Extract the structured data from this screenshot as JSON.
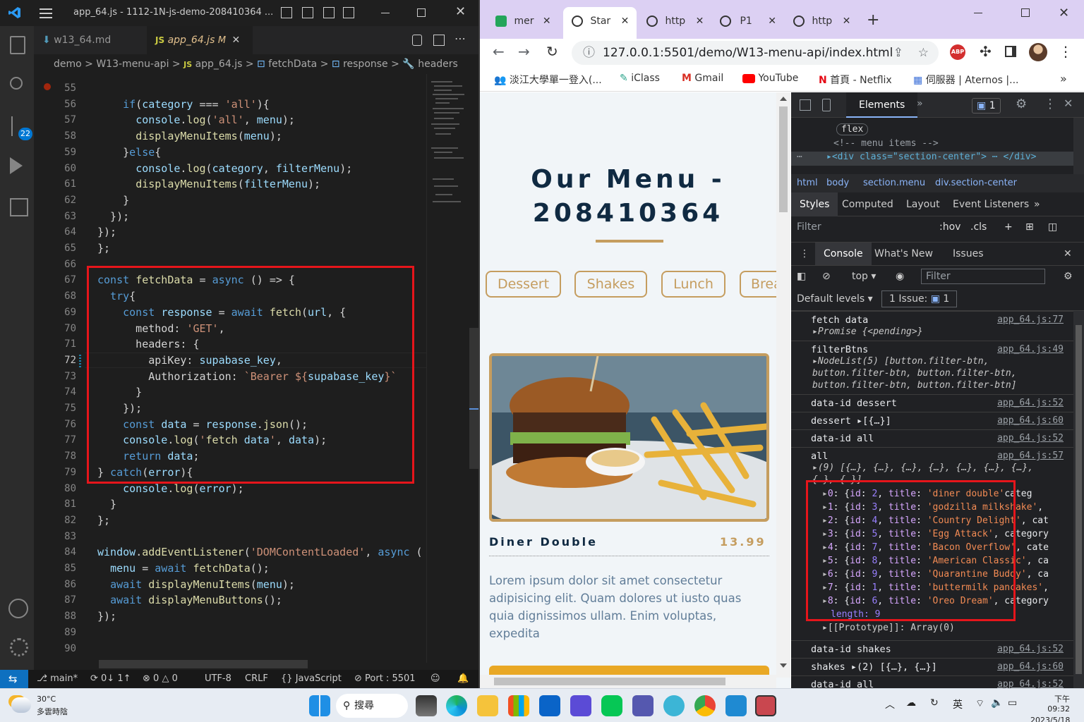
{
  "vscode": {
    "title": "app_64.js - 1112-1N-js-demo-208410364 ...",
    "tabs": [
      {
        "label": "w13_64.md",
        "icon": "markdown-icon"
      },
      {
        "label": "app_64.js",
        "badge": "M",
        "icon": "js-icon"
      }
    ],
    "breadcrumb": [
      "demo",
      "W13-menu-api",
      "app_64.js",
      "fetchData",
      "response",
      "headers"
    ],
    "scm_badge": "22",
    "line_numbers": [
      "55",
      "56",
      "57",
      "58",
      "59",
      "60",
      "61",
      "62",
      "63",
      "64",
      "65",
      "66",
      "67",
      "68",
      "69",
      "70",
      "71",
      "72",
      "73",
      "74",
      "75",
      "76",
      "77",
      "78",
      "79",
      "80",
      "81",
      "82",
      "83",
      "84",
      "85",
      "86",
      "87",
      "88",
      "89",
      "90"
    ],
    "code_lines": [
      "",
      "    if(category === 'all'){",
      "      console.log('all', menu);",
      "      displayMenuItems(menu);",
      "    }else{",
      "      console.log(category, filterMenu);",
      "      displayMenuItems(filterMenu);",
      "    }",
      "  });",
      "});",
      "};",
      "",
      "const fetchData = async () => {",
      "  try{",
      "    const response = await fetch(url, {",
      "      method: 'GET',",
      "      headers: {",
      "        apiKey: supabase_key,",
      "        Authorization: `Bearer ${supabase_key}`",
      "      }",
      "    });",
      "    const data = response.json();",
      "    console.log('fetch data', data);",
      "    return data;",
      "} catch(error){",
      "    console.log(error);",
      "  }",
      "};",
      "",
      "window.addEventListener('DOMContentLoaded', async (",
      "  menu = await fetchData();",
      "  await displayMenuItems(menu);",
      "  await displayMenuButtons();",
      "});",
      "",
      ""
    ],
    "status": {
      "branch": "main*",
      "sync": "0↓ 1↑",
      "problems": "0",
      "warnings": "0",
      "encoding": "UTF-8",
      "eol": "CRLF",
      "language": "JavaScript",
      "port": "Port : 5501"
    }
  },
  "chrome": {
    "tabs": [
      {
        "label": "mer",
        "icon": "terminal-icon"
      },
      {
        "label": "Star",
        "icon": "globe-icon"
      },
      {
        "label": "http",
        "icon": "globe-icon"
      },
      {
        "label": "P1",
        "icon": "globe-icon"
      },
      {
        "label": "http",
        "icon": "globe-icon"
      }
    ],
    "url": "127.0.0.1:5501/demo/W13-menu-api/index.html",
    "bookmarks": [
      "淡江大學單一登入(...",
      "iClass",
      "Gmail",
      "YouTube",
      "首頁 - Netflix",
      "伺服器 | Aternos |..."
    ]
  },
  "page": {
    "title": "Our Menu - 208410364",
    "filters": [
      "Dessert",
      "Shakes",
      "Lunch",
      "Brea"
    ],
    "item": {
      "title": "Diner Double",
      "price": "13.99",
      "desc": "Lorem ipsum dolor sit amet consectetur adipisicing elit. Quam dolores ut iusto quas quia dignissimos ullam. Enim voluptas, expedita"
    }
  },
  "devtools": {
    "main_tabs": [
      "Elements"
    ],
    "issues_count": "1",
    "elements_lines": [
      "flex",
      "<!-- menu items -->",
      "<div class=\"section-center\">",
      "</div>"
    ],
    "crumbs": [
      "html",
      "body",
      "section.menu",
      "div.section-center"
    ],
    "style_tabs": [
      "Styles",
      "Computed",
      "Layout",
      "Event Listeners"
    ],
    "filter_placeholder": "Filter",
    "hov": ":hov",
    "cls": ".cls",
    "drawer_tabs": [
      "Console",
      "What's New",
      "Issues"
    ],
    "context": "top",
    "levels": "Default levels",
    "issue_label": "1 Issue:",
    "issue_num": "1",
    "console": [
      {
        "text": "fetch data",
        "src": "app_64.js:77",
        "sub": [
          "Promise {<pending>}"
        ]
      },
      {
        "text": "filterBtns",
        "src": "app_64.js:49",
        "sub": [
          "NodeList(5) [button.filter-btn,",
          "button.filter-btn, button.filter-btn,",
          "button.filter-btn, button.filter-btn]"
        ]
      },
      {
        "text": "data-id dessert",
        "src": "app_64.js:52"
      },
      {
        "text": "dessert ▸[{…}]",
        "src": "app_64.js:60"
      },
      {
        "text": "data-id all",
        "src": "app_64.js:52"
      },
      {
        "text": "all",
        "src": "app_64.js:57",
        "sub": [
          "(9) [{…}, {…}, {…}, {…}, {…}, {…}, {…},",
          "{…}, {…}]"
        ]
      }
    ],
    "array_items": [
      {
        "idx": "0",
        "id": "2",
        "title": "'diner double'",
        "tail": "categ"
      },
      {
        "idx": "1",
        "id": "3",
        "title": "'godzilla milkshake'",
        "tail": ","
      },
      {
        "idx": "2",
        "id": "4",
        "title": "'Country Delight'",
        "tail": ", cat"
      },
      {
        "idx": "3",
        "id": "5",
        "title": "'Egg Attack'",
        "tail": ", category"
      },
      {
        "idx": "4",
        "id": "7",
        "title": "'Bacon Overflow'",
        "tail": ", cate"
      },
      {
        "idx": "5",
        "id": "8",
        "title": "'American Classic'",
        "tail": ", ca"
      },
      {
        "idx": "6",
        "id": "9",
        "title": "'Quarantine Buddy'",
        "tail": ", ca"
      },
      {
        "idx": "7",
        "id": "1",
        "title": "'buttermilk pancakes'",
        "tail": ","
      },
      {
        "idx": "8",
        "id": "6",
        "title": "'Oreo Dream'",
        "tail": ", category"
      }
    ],
    "length_label": "length: 9",
    "prototype_label": "[[Prototype]]: Array(0)",
    "tail_console": [
      {
        "text": "data-id shakes",
        "src": "app_64.js:52"
      },
      {
        "text": "shakes ▸(2) [{…}, {…}]",
        "src": "app_64.js:60"
      },
      {
        "text": "data-id all",
        "src": "app_64.js:52"
      }
    ]
  },
  "taskbar": {
    "weather_temp": "30°C",
    "weather_desc": "多雲時陰",
    "search": "搜尋",
    "time": "下午 09:32",
    "date": "2023/5/18",
    "ime": "英"
  }
}
